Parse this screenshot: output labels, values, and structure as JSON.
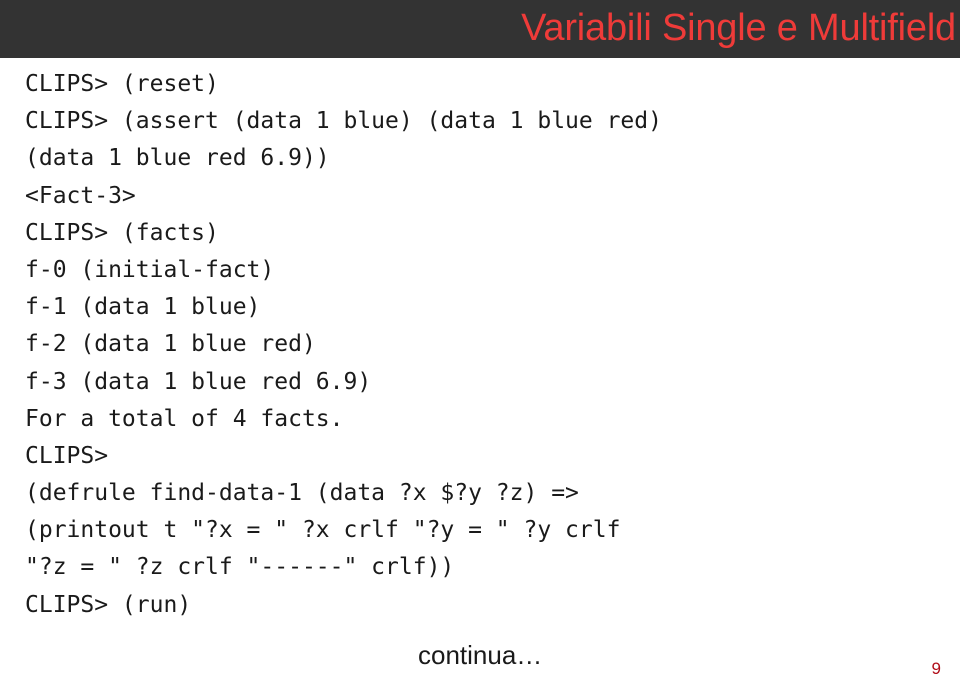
{
  "slide": {
    "title": "Variabili Single e Multifield",
    "title_color": "#ef3b39",
    "title_bar_color": "#333333",
    "page_number": "9",
    "page_number_color": "#b00d18",
    "footer_note": "continua…"
  },
  "terminal": {
    "lines": [
      "CLIPS> (reset)",
      "CLIPS> (assert (data 1 blue) (data 1 blue red)",
      "(data 1 blue red 6.9))",
      "<Fact-3>",
      "CLIPS> (facts)",
      "f-0 (initial-fact)",
      "f-1 (data 1 blue)",
      "f-2 (data 1 blue red)",
      "f-3 (data 1 blue red 6.9)",
      "For a total of 4 facts.",
      "CLIPS>",
      "(defrule find-data-1 (data ?x $?y ?z) =>",
      "(printout t \"?x = \" ?x crlf \"?y = \" ?y crlf",
      "\"?z = \" ?z crlf \"------\" crlf))",
      "CLIPS> (run)"
    ]
  }
}
